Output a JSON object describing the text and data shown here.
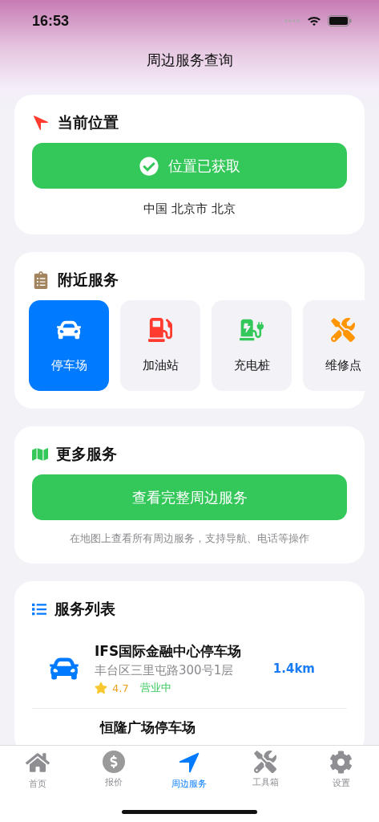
{
  "status_bar": {
    "time": "16:53"
  },
  "header": {
    "title": "周边服务查询"
  },
  "location_card": {
    "title": "当前位置",
    "status_button": {
      "label": "位置已获取",
      "checked": true
    },
    "address": "中国 北京市 北京"
  },
  "nearby_card": {
    "title": "附近服务",
    "services": [
      {
        "kind": "parking",
        "label": "停车场",
        "selected": true
      },
      {
        "kind": "fuel",
        "label": "加油站",
        "selected": false
      },
      {
        "kind": "charging",
        "label": "充电桩",
        "selected": false
      },
      {
        "kind": "repair",
        "label": "维修点",
        "selected": false
      }
    ]
  },
  "more_card": {
    "title": "更多服务",
    "button": "查看完整周边服务",
    "caption": "在地图上查看所有周边服务，支持导航、电话等操作"
  },
  "list_card": {
    "title": "服务列表",
    "items": [
      {
        "kind": "parking",
        "name": "IFS国际金融中心停车场",
        "address": "丰台区三里屯路300号1层",
        "rating": "4.7",
        "status": "营业中",
        "distance": "1.4km"
      },
      {
        "name": "恒隆广场停车场"
      }
    ]
  },
  "tab_bar": [
    {
      "kind": "home",
      "label": "首页",
      "selected": false
    },
    {
      "kind": "quote",
      "label": "报价",
      "selected": false
    },
    {
      "kind": "nearby",
      "label": "周边服务",
      "selected": true
    },
    {
      "kind": "tools",
      "label": "工具箱",
      "selected": false
    },
    {
      "kind": "settings",
      "label": "设置",
      "selected": false
    }
  ]
}
